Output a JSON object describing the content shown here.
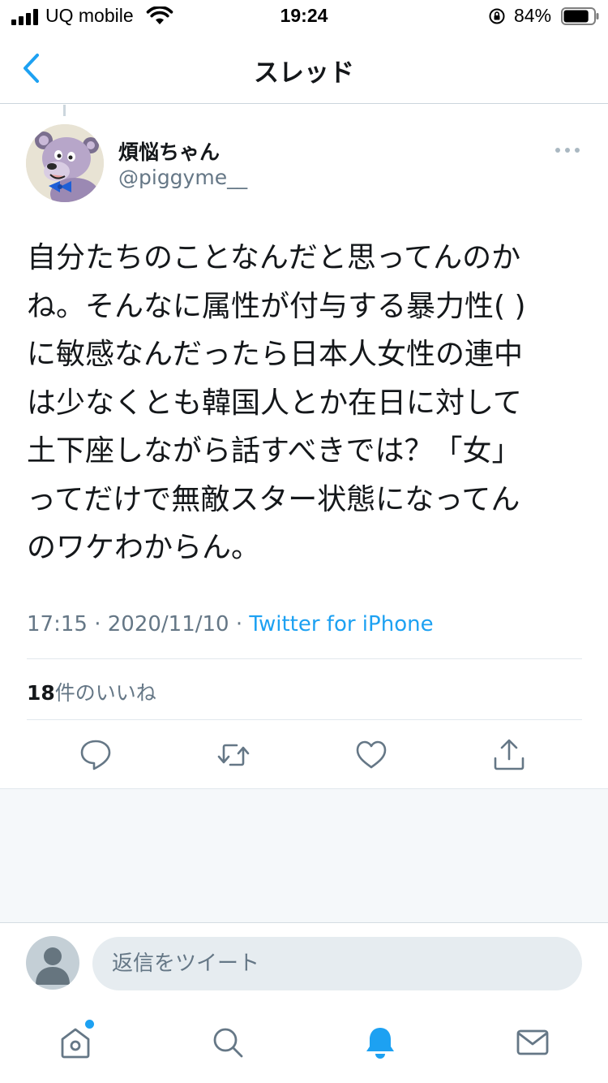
{
  "status_bar": {
    "carrier": "UQ mobile",
    "time": "19:24",
    "battery": "84%",
    "battery_level": 0.84
  },
  "nav": {
    "title": "スレッド",
    "back_icon": "chevron-left-icon"
  },
  "tweet": {
    "author_name": "煩悩ちゃん",
    "author_handle": "@piggyme__",
    "text": "自分たちのことなんだと思ってんのか\nね。そんなに属性が付与する暴力性( )\nに敏感なんだったら日本人女性の連中\nは少なくとも韓国人とか在日に対して\n土下座しながら話すべきでは？「女」\nってだけで無敵スター状態になってん\nのワケわからん。",
    "time": "17:15",
    "date": "2020/11/10",
    "separator": " · ",
    "source": "Twitter for iPhone",
    "likes_count": "18",
    "likes_label": "件のいいね"
  },
  "actions": [
    "reply-icon",
    "retweet-icon",
    "like-icon",
    "share-icon"
  ],
  "reply_bar": {
    "placeholder": "返信をツイート"
  },
  "tab_bar": [
    "home-icon",
    "search-icon",
    "notifications-icon",
    "messages-icon"
  ],
  "colors": {
    "accent": "#1da1f2",
    "secondary_text": "#657786",
    "primary_text": "#14171a",
    "divider": "#e1e8ed"
  }
}
